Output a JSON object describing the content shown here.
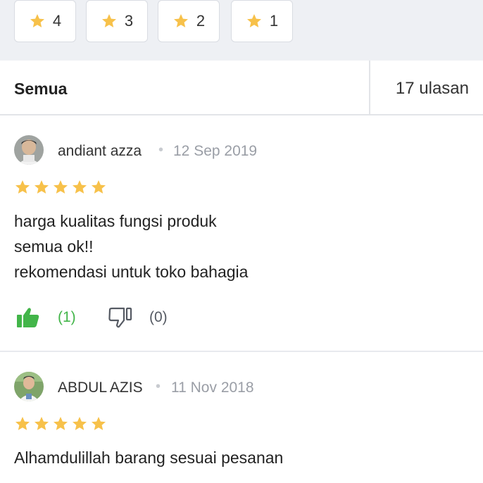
{
  "filters": [
    {
      "label": "4",
      "icon": "star-icon"
    },
    {
      "label": "3",
      "icon": "star-icon"
    },
    {
      "label": "2",
      "icon": "star-icon"
    },
    {
      "label": "1",
      "icon": "star-icon"
    }
  ],
  "summary": {
    "all_label": "Semua",
    "count_label": "17 ulasan"
  },
  "reviews": [
    {
      "name": "andiant azza",
      "date": "12 Sep 2019",
      "rating": 5,
      "lines": [
        "harga kualitas fungsi produk",
        "semua ok!!",
        "rekomendasi untuk toko bahagia"
      ],
      "helpful": "(1)",
      "not_helpful": "(0)"
    },
    {
      "name": "ABDUL AZIS",
      "date": "11 Nov 2018",
      "rating": 5,
      "lines": [
        "Alhamdulillah barang sesuai pesanan"
      ]
    }
  ],
  "colors": {
    "star": "#F7C14A",
    "green": "#42B549",
    "muted": "#9A9EA6",
    "background": "#EEF0F4"
  }
}
